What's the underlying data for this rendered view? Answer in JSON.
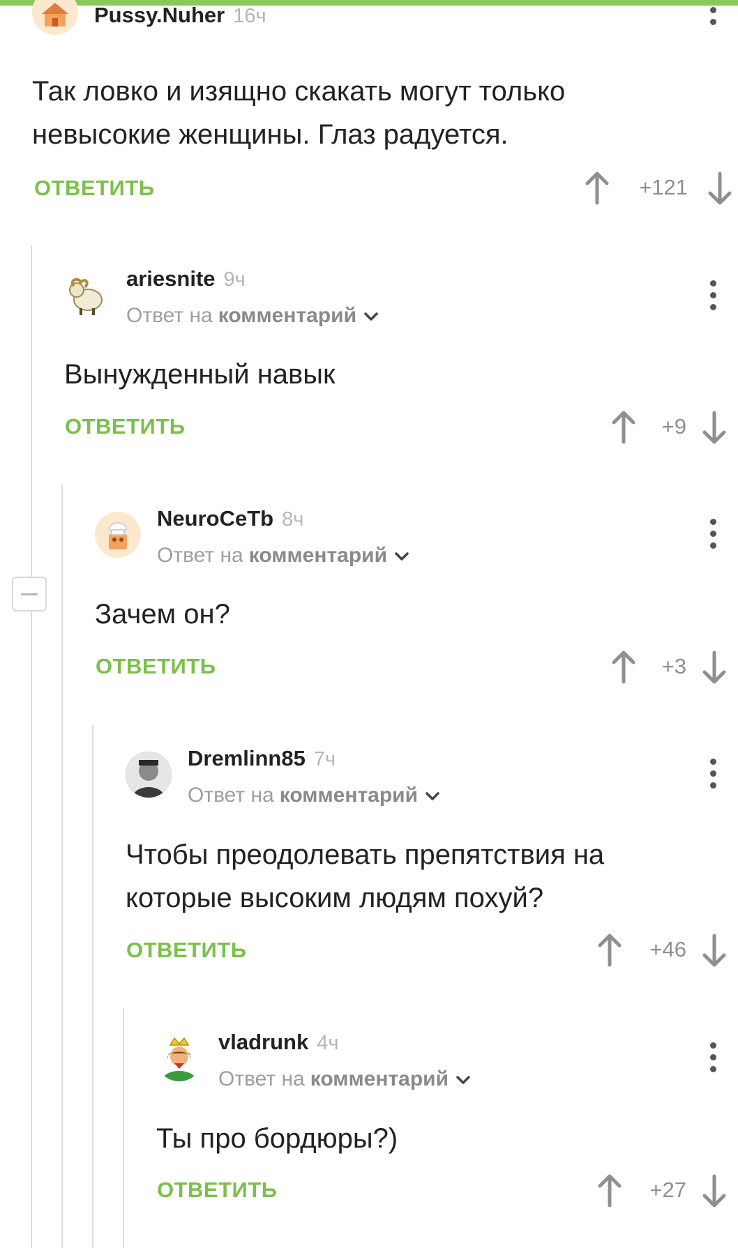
{
  "ui": {
    "reply_label": "ОТВЕТИТЬ",
    "reply_prefix": "Ответ на",
    "reply_link": "комментарий"
  },
  "comments": [
    {
      "username": "Pussy.Nuher",
      "time": "16ч",
      "text": "Так ловко и изящно скакать могут только невысокие женщины. Глаз радуется.",
      "score": "+121",
      "avatar": "fox-house-avatar"
    },
    {
      "username": "ariesnite",
      "time": "9ч",
      "text": "Вынужденный навык",
      "score": "+9",
      "avatar": "ram-avatar"
    },
    {
      "username": "NeuroCeTb",
      "time": "8ч",
      "text": "Зачем он?",
      "score": "+3",
      "avatar": "chef-avatar"
    },
    {
      "username": "Dremlinn85",
      "time": "7ч",
      "text": "Чтобы преодолевать препятствия на которые высоким людям похуй?",
      "score": "+46",
      "avatar": "photo-avatar"
    },
    {
      "username": "vladrunk",
      "time": "4ч",
      "text": "Ты про бордюры?)",
      "score": "+27",
      "avatar": "king-avatar"
    }
  ],
  "colors": {
    "accent": "#7cbf4b",
    "strip": "#8ac858",
    "thread_line": "#dcdcdc"
  }
}
